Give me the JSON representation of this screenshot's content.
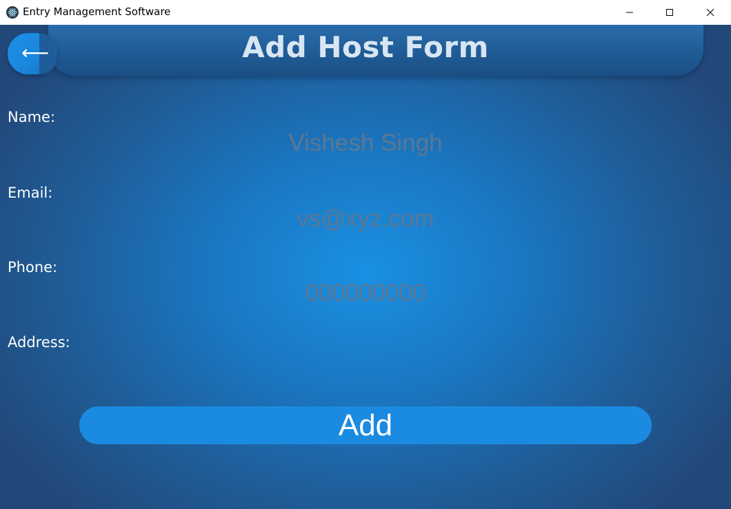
{
  "window": {
    "title": "Entry Management Software",
    "icon": "electron-app-icon"
  },
  "header": {
    "title": "Add Host Form",
    "back_symbol": "⟵"
  },
  "form": {
    "fields": [
      {
        "label": "Name:",
        "placeholder": "Vishesh Singh",
        "value": ""
      },
      {
        "label": "Email:",
        "placeholder": "vs@xyz.com",
        "value": ""
      },
      {
        "label": "Phone:",
        "placeholder": "000000000",
        "value": ""
      },
      {
        "label": "Address:",
        "placeholder": "",
        "value": ""
      }
    ],
    "submit_label": "Add"
  },
  "colors": {
    "accent": "#1a8be0",
    "background_center": "#1a90e2",
    "background_edge": "#22487a",
    "header_bar": "#1f5a94",
    "placeholder_text": "#5d7792"
  }
}
